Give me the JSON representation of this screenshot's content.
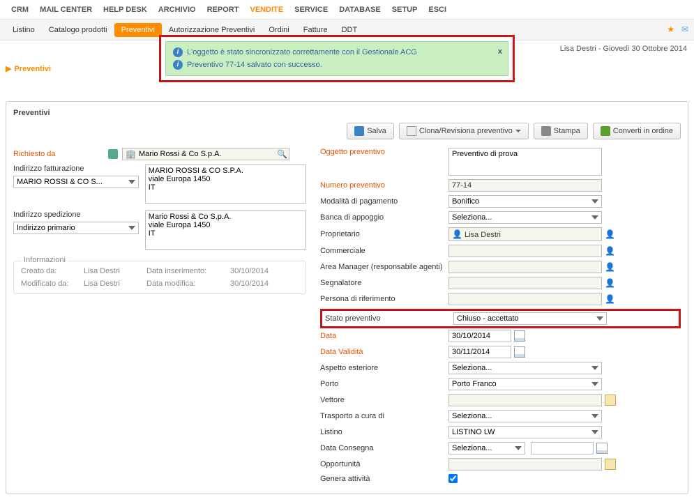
{
  "nav": {
    "top": [
      "CRM",
      "MAIL CENTER",
      "HELP DESK",
      "ARCHIVIO",
      "REPORT",
      "VENDITE",
      "SERVICE",
      "DATABASE",
      "SETUP",
      "ESCI"
    ],
    "top_active_index": 5,
    "sub": [
      "Listino",
      "Catalogo prodotti",
      "Preventivi",
      "Autorizzazione Preventivi",
      "Ordini",
      "Fatture",
      "DDT"
    ],
    "sub_active_index": 2
  },
  "userbar": "Lisa Destri - Giovedì 30 Ottobre 2014",
  "message": {
    "line1": "L'oggetto è stato sincronizzato correttamente con il Gestionale ACG",
    "line2": "Preventivo 77-14 salvato con successo.",
    "close": "x"
  },
  "breadcrumb": "Preventivi",
  "panel_title": "Preventivi",
  "toolbar": {
    "save": "Salva",
    "clone": "Clona/Revisiona preventivo",
    "print": "Stampa",
    "convert": "Converti in ordine"
  },
  "left": {
    "richiesto_da_label": "Richiesto da",
    "richiesto_da_value": "Mario Rossi & Co S.p.A.",
    "indirizzo_fatt_label": "Indirizzo fatturazione",
    "indirizzo_fatt_text": "MARIO ROSSI & CO S.P.A.\nviale Europa 1450\nIT",
    "fatt_select": "MARIO ROSSI & CO S...",
    "indirizzo_sped_label": "Indirizzo spedizione",
    "indirizzo_sped_text": "Mario Rossi & Co S.p.A.\nviale Europa 1450\nIT",
    "sped_select": "Indirizzo primario",
    "info_title": "Informazioni",
    "creato_da_label": "Creato da:",
    "creato_da_value": "Lisa Destri",
    "data_ins_label": "Data inserimento:",
    "data_ins_value": "30/10/2014",
    "mod_da_label": "Modificato da:",
    "mod_da_value": "Lisa Destri",
    "data_mod_label": "Data modifica:",
    "data_mod_value": "30/10/2014"
  },
  "right": {
    "oggetto_label": "Oggetto preventivo",
    "oggetto_value": "Preventivo di prova",
    "numero_label": "Numero preventivo",
    "numero_value": "77-14",
    "pagamento_label": "Modalità di pagamento",
    "pagamento_value": "Bonifico",
    "banca_label": "Banca di appoggio",
    "banca_value": "Seleziona...",
    "proprietario_label": "Proprietario",
    "proprietario_value": "Lisa Destri",
    "commerciale_label": "Commerciale",
    "area_manager_label": "Area Manager (responsabile agenti)",
    "segnalatore_label": "Segnalatore",
    "persona_rif_label": "Persona di riferimento",
    "stato_label": "Stato preventivo",
    "stato_value": "Chiuso - accettato",
    "data_label": "Data",
    "data_value": "30/10/2014",
    "data_validita_label": "Data Validità",
    "data_validita_value": "30/11/2014",
    "aspetto_label": "Aspetto esteriore",
    "aspetto_value": "Seleziona...",
    "porto_label": "Porto",
    "porto_value": "Porto Franco",
    "vettore_label": "Vettore",
    "trasporto_label": "Trasporto a cura di",
    "trasporto_value": "Seleziona...",
    "listino_label": "Listino",
    "listino_value": "LISTINO LW",
    "consegna_label": "Data Consegna",
    "consegna_value": "Seleziona...",
    "opportunita_label": "Opportunità",
    "genera_label": "Genera attività"
  }
}
